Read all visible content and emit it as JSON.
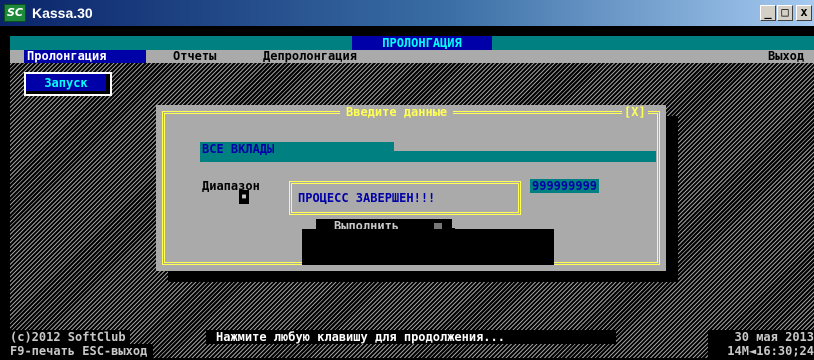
{
  "window": {
    "title": "Kassa.30",
    "icon_text": "SC",
    "icon": "softclub-app-icon",
    "controls": {
      "minimize": "_",
      "maximize": "□",
      "close": "x"
    }
  },
  "header": {
    "mode_title": "ПРОЛОНГАЦИЯ"
  },
  "menu": {
    "items": [
      {
        "label": "Пролонгация",
        "active": true
      },
      {
        "label": "Отчеты",
        "active": false
      },
      {
        "label": "Депролонгация",
        "active": false
      }
    ],
    "exit_label": "Выход"
  },
  "toolbar": {
    "run_label": "Запуск"
  },
  "dialog": {
    "title": "Введите данные",
    "close_label": "[X]",
    "deposits_label": "ВСЕ ВКЛАДЫ",
    "range_label": "Диапазон",
    "range_to": "999999999",
    "execute_label": "Выполнить"
  },
  "popup": {
    "message": "ПРОЦЕСС ЗАВЕРШЕН!!!"
  },
  "status": {
    "copyright": "(c)2012 SoftClub",
    "press_any_key": "Нажмите любую клавишу для продолжения...",
    "date": "30 мая 2013",
    "hints": "F9-печать ESC-выход",
    "clock": "14M◄16:30;24"
  },
  "colors": {
    "dos_blue": "#0000a8",
    "dos_cyan": "#00ffff",
    "dos_teal": "#008080",
    "dos_gray": "#aaaaaa",
    "dos_yellow": "#ffff55"
  }
}
